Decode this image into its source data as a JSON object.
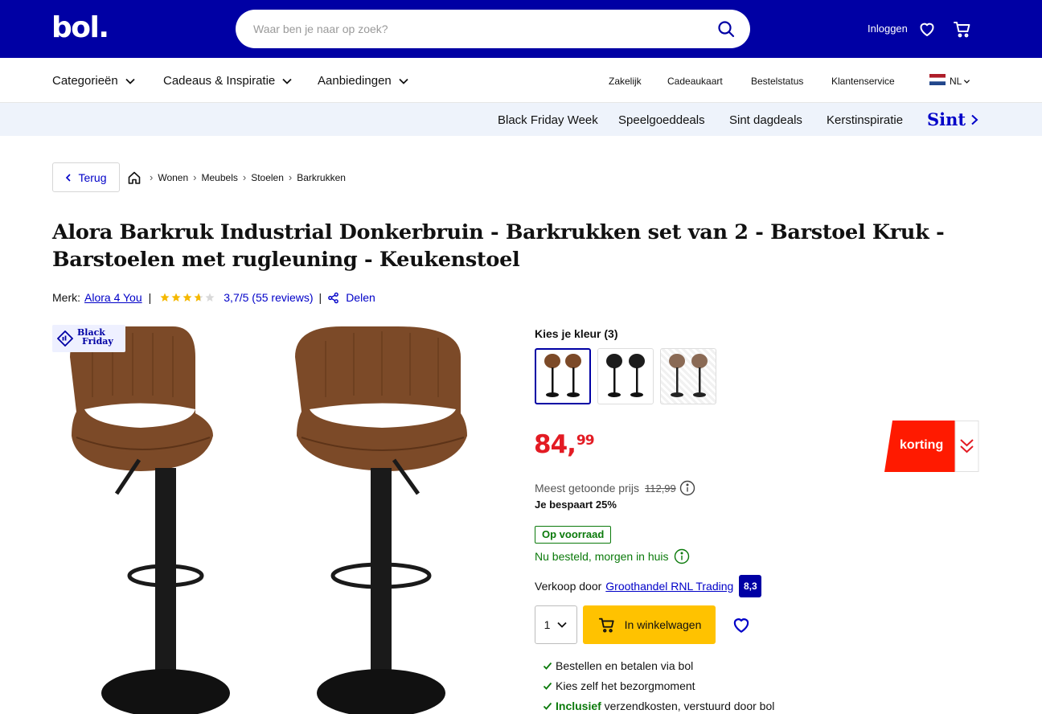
{
  "header": {
    "logo": "bol.",
    "search_placeholder": "Waar ben je naar op zoek?",
    "login": "Inloggen",
    "bg_color": "#0000a4"
  },
  "nav": {
    "left": [
      "Categorieën",
      "Cadeaus & Inspiratie",
      "Aanbiedingen"
    ],
    "right": [
      "Zakelijk",
      "Cadeaukaart",
      "Bestelstatus",
      "Klantenservice"
    ],
    "language": "NL"
  },
  "promo": {
    "items": [
      "Black Friday Week",
      "Speelgoeddeals",
      "Sint dagdeals",
      "Kerstinspiratie"
    ],
    "highlight": "Sint"
  },
  "breadcrumb": {
    "back": "Terug",
    "items": [
      "Wonen",
      "Meubels",
      "Stoelen",
      "Barkrukken"
    ]
  },
  "product": {
    "title": "Alora Barkruk Industrial Donkerbruin - Barkrukken set van 2 - Barstoel Kruk - Barstoelen met rugleuning - Keukenstoel",
    "brand_label": "Merk:",
    "brand": "Alora 4 You",
    "rating": "3,7/5 (55 reviews)",
    "rating_value": 3.7,
    "share": "Delen",
    "badge": "Black Friday",
    "badge_line1": "Black",
    "badge_line2": "Friday"
  },
  "buybox": {
    "color_label": "Kies je kleur (3)",
    "swatches": [
      "brown",
      "black",
      "grey-brown"
    ],
    "price_whole": "84,",
    "price_cents": "99",
    "discount_label": "korting",
    "most_shown_label": "Meest getoonde prijs",
    "old_price": "112,99",
    "saving": "Je bespaart 25%",
    "stock": "Op voorraad",
    "delivery": "Nu besteld, morgen in huis",
    "seller_label": "Verkoop door",
    "seller": "Groothandel RNL Trading",
    "seller_score": "8,3",
    "quantity": "1",
    "cart_button": "In winkelwagen",
    "usps": [
      {
        "pre": "Bestellen en betalen via bol",
        "bold": "",
        "post": ""
      },
      {
        "pre": "Kies zelf het bezorgmoment",
        "bold": "",
        "post": ""
      },
      {
        "pre": "",
        "bold": "Inclusief",
        "post": " verzendkosten, verstuurd door bol"
      }
    ],
    "price_color": "#e31b23",
    "cart_color": "#ffc200"
  }
}
